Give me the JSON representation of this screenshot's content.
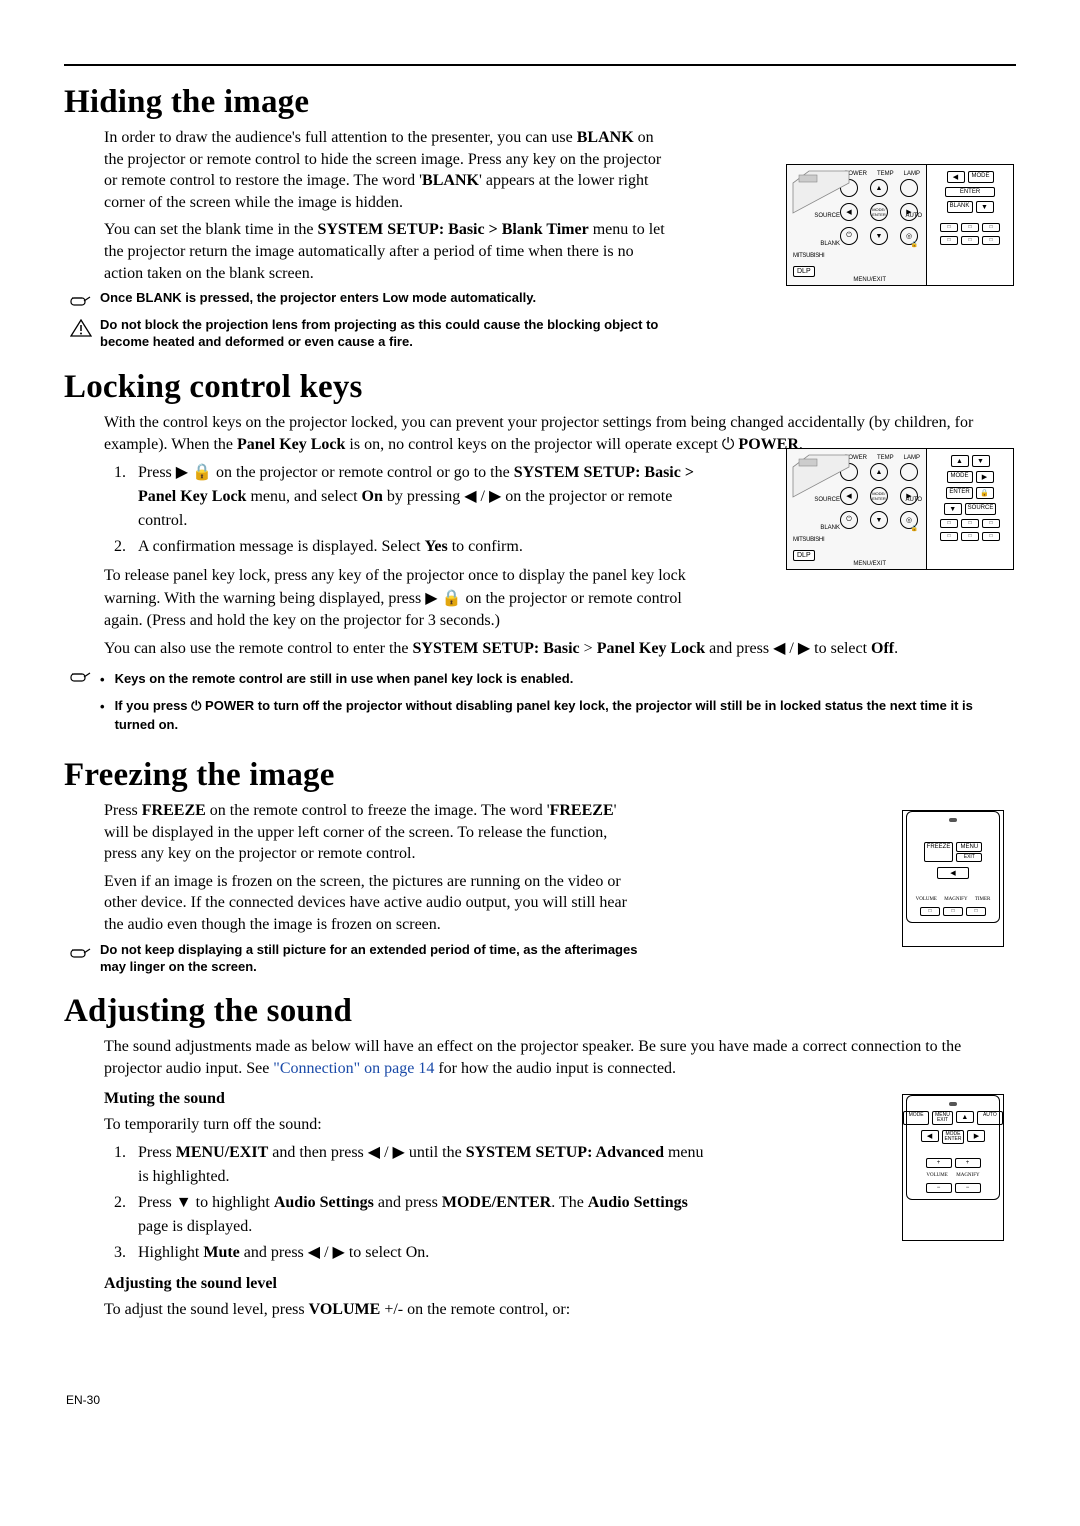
{
  "footer": "EN-30",
  "sec1": {
    "title": "Hiding the image",
    "p1": "In order to draw the audience's full attention to the presenter, you can use BLANK on the projector or remote control to hide the screen image. Press any key on the projector or remote control to restore the image. The word 'BLANK' appears at the lower right corner of the screen while the image is hidden.",
    "p2": "You can set the blank time in the SYSTEM SETUP: Basic > Blank Timer menu to let the projector return the image automatically after a period of time when there is no action taken on the blank screen.",
    "note1": "Once BLANK is pressed, the projector enters Low mode automatically.",
    "warn1": "Do not block the projection lens from projecting as this could cause the blocking object to become heated and deformed or even cause a fire."
  },
  "sec2": {
    "title": "Locking control keys",
    "p1a": "With the control keys on the projector locked, you can prevent your projector settings from being changed accidentally (by children, for example). When the ",
    "p1b": "Panel Key Lock",
    "p1c": " is on, no control keys on the projector will operate except ",
    "p1d": "POWER",
    "p1e": ".",
    "li1a": "Press ▶ 🔒 on the projector or remote control or go to the ",
    "li1b": "SYSTEM SETUP: Basic > Panel Key Lock",
    "li1c": " menu, and select ",
    "li1d": "On",
    "li1e": " by pressing ◀ / ▶ on the projector or remote control.",
    "li2a": "A confirmation message is displayed. Select ",
    "li2b": "Yes",
    "li2c": " to confirm.",
    "p2": "To release panel key lock, press any key of the projector once to display the panel key lock warning. With the warning being displayed, press ▶ 🔒 on the projector or remote control again. (Press and hold the key on the projector for 3 seconds.)",
    "p3a": "You can also use the remote control to enter the ",
    "p3b": "SYSTEM SETUP: Basic",
    "p3c": " > ",
    "p3d": "Panel Key Lock",
    "p3e": " and press ◀ / ▶ to select ",
    "p3f": "Off",
    "p3g": ".",
    "bul1": "Keys on the remote control are still in use when panel key lock is enabled.",
    "bul2": "If you press ⏻ POWER to turn off the projector without disabling panel key lock, the projector will still be in locked status the next time it is turned on."
  },
  "sec3": {
    "title": "Freezing the image",
    "p1a": "Press ",
    "p1b": "FREEZE",
    "p1c": " on the remote control to freeze the image. The word '",
    "p1d": "FREEZE",
    "p1e": "' will be displayed in the upper left corner of the screen. To release the function, press any key on the projector or remote control.",
    "p2": "Even if an image is frozen on the screen, the pictures are running on the video or other device. If the connected devices have active audio output, you will still hear the audio even though the image is frozen on screen.",
    "note1": "Do not keep displaying a still picture for an extended period of time, as the afterimages may linger on the screen."
  },
  "sec4": {
    "title": "Adjusting the sound",
    "p1a": "The sound adjustments made as below will have an effect on the projector speaker. Be sure you have made a correct connection to the projector audio input. See ",
    "p1link": "\"Connection\" on page 14",
    "p1b": " for how the audio input is connected.",
    "sub1": "Muting the sound",
    "p2": "To temporarily turn off the sound:",
    "li1a": "Press ",
    "li1b": "MENU/EXIT",
    "li1c": " and then press ◀ / ▶ until the ",
    "li1d": "SYSTEM SETUP: Advanced",
    "li1e": " menu is highlighted.",
    "li2a": "Press ▼ to highlight ",
    "li2b": "Audio Settings",
    "li2c": " and press ",
    "li2d": "MODE/ENTER",
    "li2e": ". The ",
    "li2f": "Audio Settings",
    "li2g": " page is displayed.",
    "li3a": "Highlight ",
    "li3b": "Mute",
    "li3c": " and press ◀ / ▶ to select On.",
    "sub2": "Adjusting the sound level",
    "p3a": "To adjust the sound level, press ",
    "p3b": "VOLUME",
    "p3c": " +/- on the remote control, or:"
  },
  "figs": {
    "panel": {
      "power": "POWER",
      "temp": "TEMP",
      "lamp": "LAMP",
      "source": "SOURCE",
      "auto": "AUTO",
      "blank": "BLANK",
      "mode_enter": "MODE/\nENTER",
      "menu_exit": "MENU/EXIT",
      "mitsubishi": "MITSUBISHI",
      "dlp": "DLP"
    },
    "remote_a": {
      "mode": "MODE",
      "enter": "ENTER",
      "blank": "BLANK"
    },
    "remote_b": {
      "mode": "MODE",
      "enter": "ENTER",
      "source": "SOURCE"
    },
    "remote_c": {
      "freeze": "FREEZE",
      "menu": "MENU",
      "exit": "EXIT",
      "volume": "VOLUME",
      "magnify": "MAGNIFY",
      "timer": "TIMER"
    },
    "remote_d": {
      "mode": "MODE",
      "menu": "MENU",
      "exit": "EXIT",
      "auto": "AUTO",
      "enter": "ENTER",
      "volume": "VOLUME",
      "magnify": "MAGNIFY"
    }
  }
}
